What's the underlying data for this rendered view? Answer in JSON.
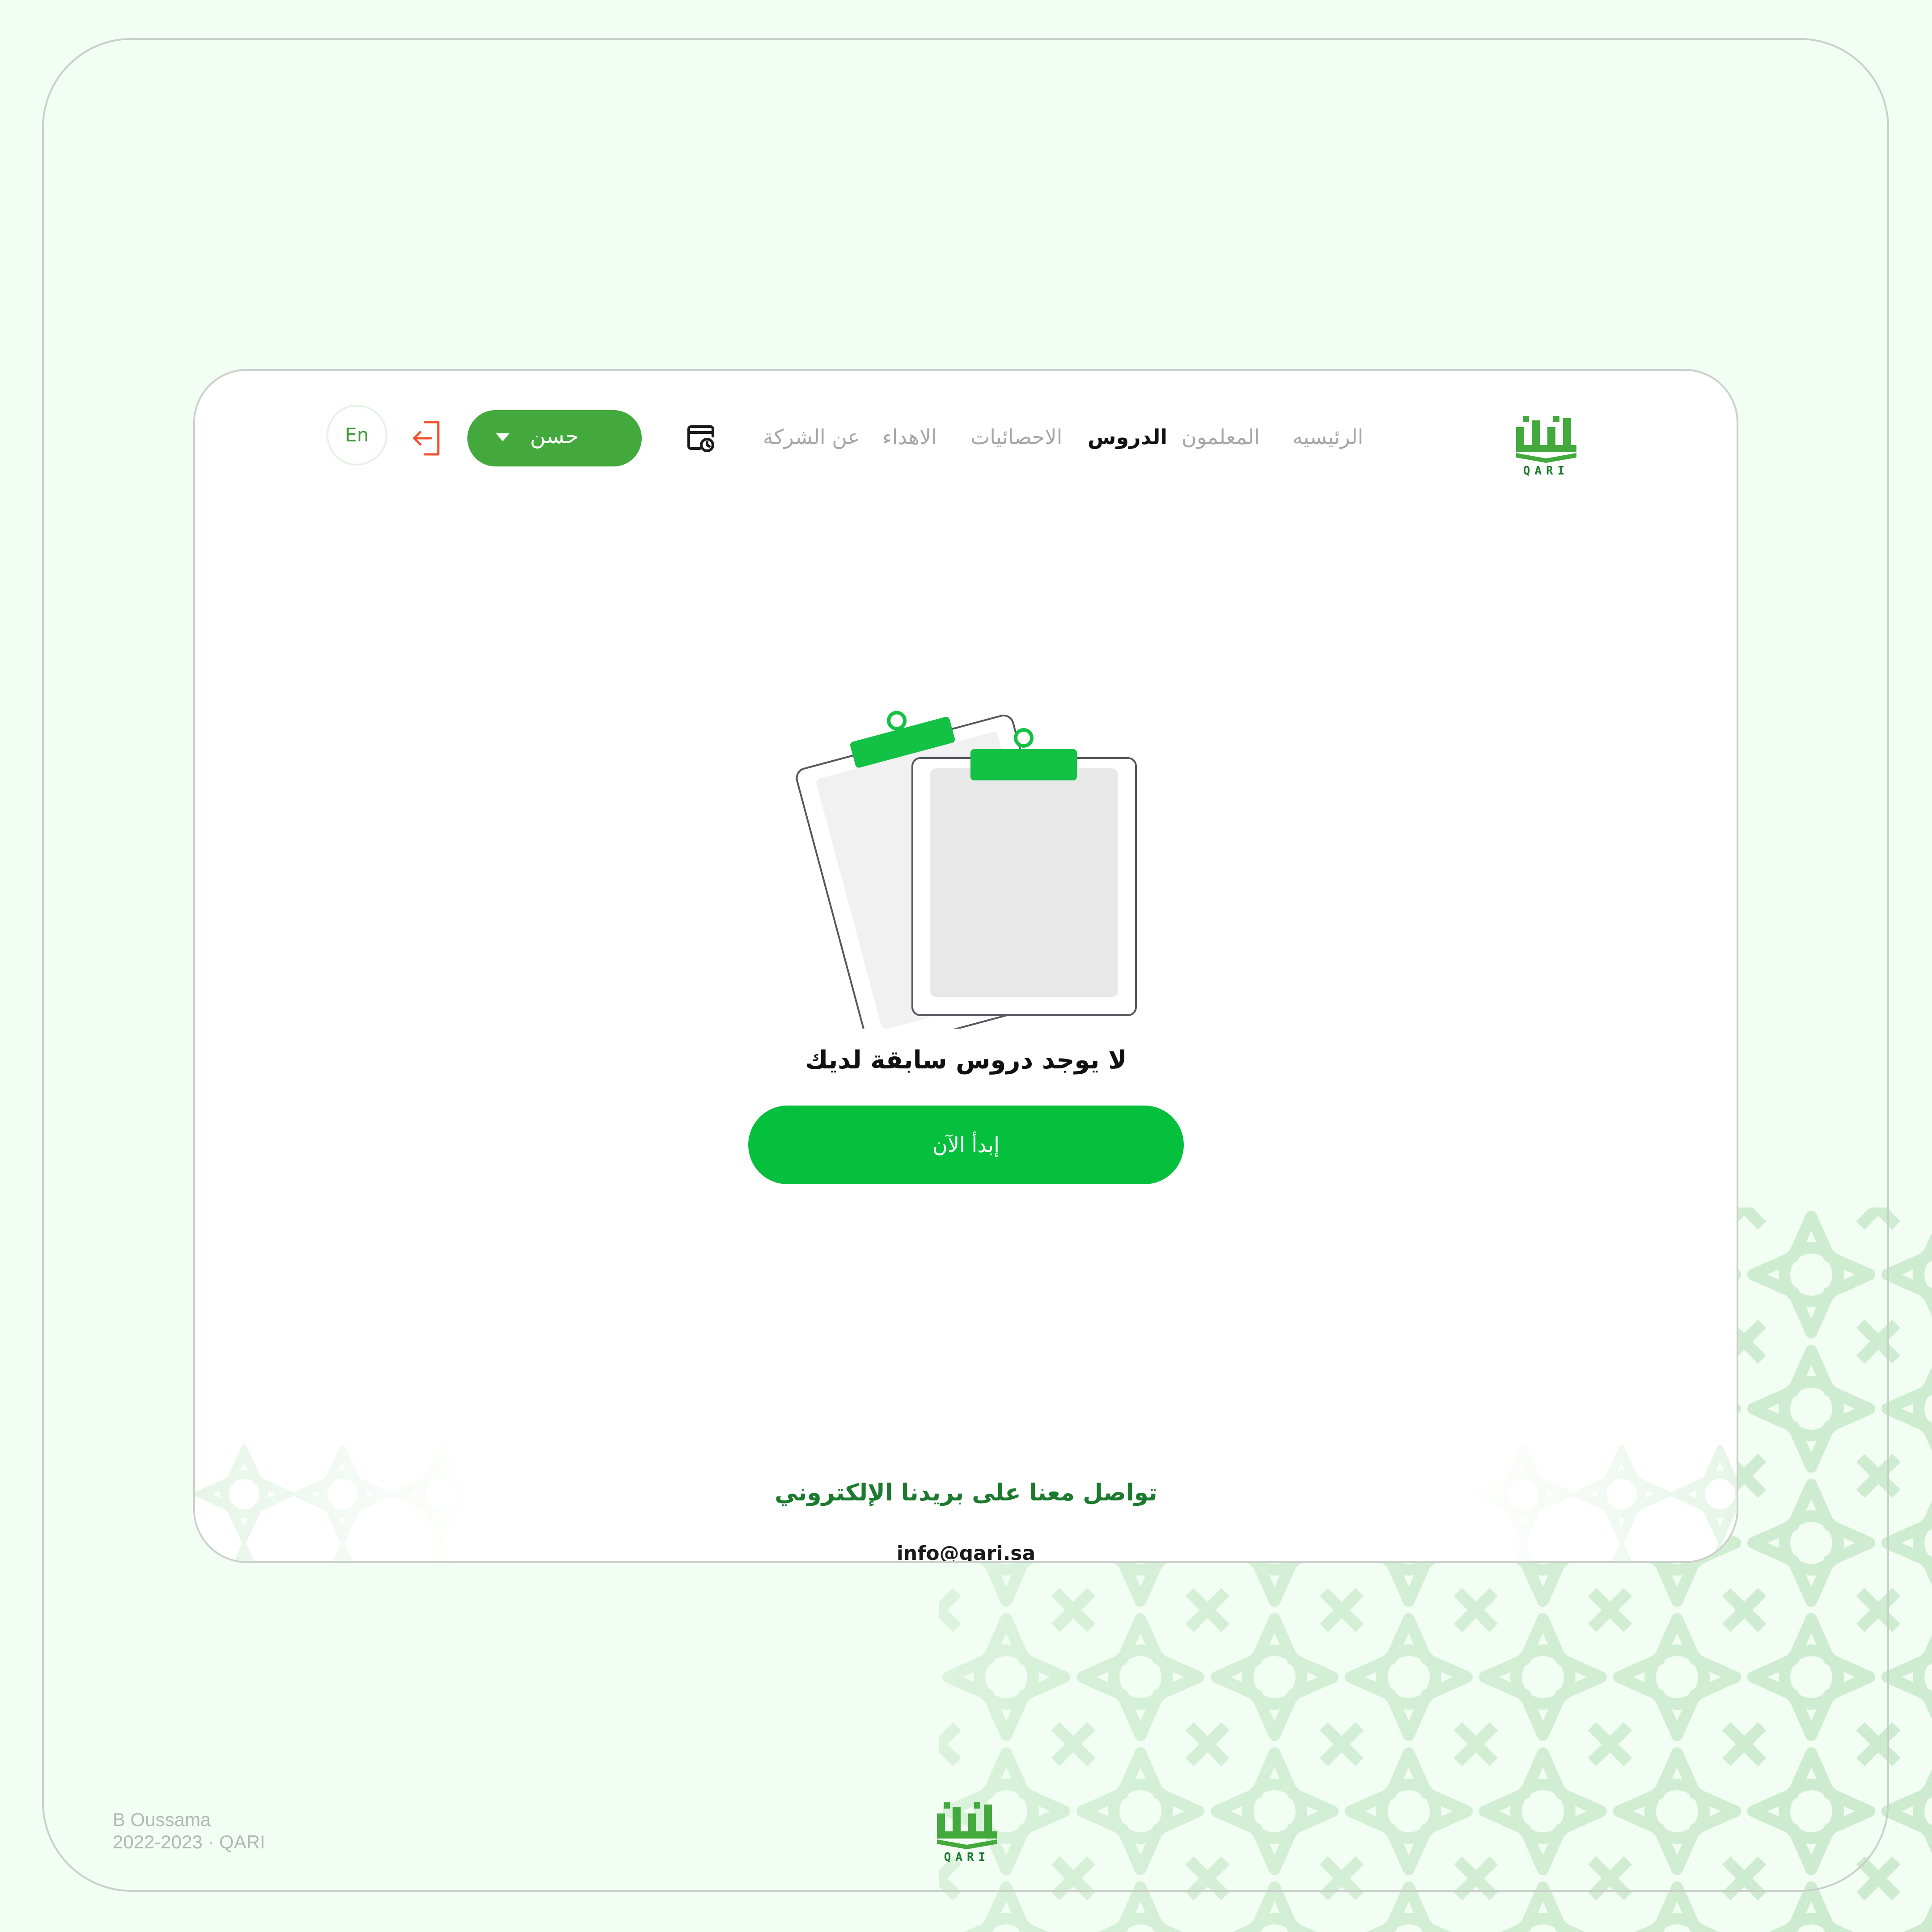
{
  "brand": {
    "logo_text": "QARI",
    "logo_arabic": "قارئ"
  },
  "nav": {
    "items": [
      {
        "label": "الرئيسيه",
        "active": false
      },
      {
        "label": "المعلمون",
        "active": false
      },
      {
        "label": "الدروس",
        "active": true
      },
      {
        "label": "الاحصائيات",
        "active": false
      },
      {
        "label": "الاهداء",
        "active": false
      },
      {
        "label": "عن الشركة",
        "active": false
      }
    ]
  },
  "header": {
    "user_name": "حسن",
    "language_label": "En",
    "icons": [
      "calendar-clock-icon",
      "logout-icon",
      "chevron-down-icon"
    ]
  },
  "empty_state": {
    "message": "لا يوجد دروس سابقة لديك",
    "cta_label": "إبدأ الآن"
  },
  "footer": {
    "contact_title": "تواصل معنا على بريدنا الإلكتروني",
    "email": "info@qari.sa"
  },
  "credits": {
    "author": "B Oussama",
    "year_project": "2022-2023 · QARI"
  },
  "colors": {
    "brand_green": "#43a93c",
    "cta_green": "#05c03c",
    "dark_green": "#1b7a2e",
    "logout_orange": "#f0522f",
    "page_bg": "#f2fdf3"
  }
}
